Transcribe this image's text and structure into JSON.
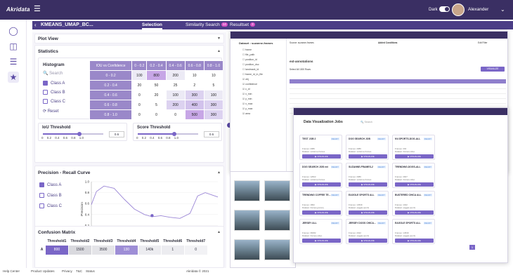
{
  "app": {
    "logo": "Akridata",
    "theme_label": "Dark",
    "user_name": "Alexander"
  },
  "subheader": {
    "title": "KMEANS_UMAP_BC...",
    "tabs": [
      {
        "label": "Selection"
      },
      {
        "label": "Similarity Search",
        "badge": "14"
      },
      {
        "label": "Resultset",
        "badge": "3"
      }
    ]
  },
  "plot_view": {
    "title": "Plot View"
  },
  "statistics": {
    "title": "Statistics",
    "histogram": {
      "title": "Histogram",
      "search_placeholder": "Search",
      "classes": [
        {
          "label": "Class A",
          "checked": true
        },
        {
          "label": "Class B",
          "checked": false
        },
        {
          "label": "Class C",
          "checked": false
        }
      ],
      "reset": "Reset"
    },
    "heatmap": {
      "corner": "IOU vs Confidence",
      "cols": [
        "0 - 0.2",
        "0.2 - 0.4",
        "0.4 - 0.6",
        "0.6 - 0.8",
        "0.8 - 1.0"
      ],
      "rows": [
        {
          "label": "0 - 0.2",
          "vals": [
            "100",
            "800",
            "200",
            "10",
            "10"
          ]
        },
        {
          "label": "0.2 - 0.4",
          "vals": [
            "20",
            "50",
            "25",
            "2",
            "5"
          ]
        },
        {
          "label": "0.4 - 0.6",
          "vals": [
            "0",
            "20",
            "100",
            "300",
            "100"
          ]
        },
        {
          "label": "0.6 - 0.8",
          "vals": [
            "0",
            "5",
            "200",
            "400",
            "300"
          ]
        },
        {
          "label": "0.8 - 1.0",
          "vals": [
            "0",
            "0",
            "0",
            "500",
            "300"
          ]
        }
      ]
    },
    "iou_threshold": {
      "title": "IoU Threshold",
      "ticks": "0 0.2 0.4 0.6 0.8 1.0",
      "value": "0.6",
      "level": 0.6
    },
    "score_threshold": {
      "title": "Score Threshold",
      "ticks": "0 0.2 0.4 0.6 0.8 1.0",
      "value": "0.6",
      "level": 0.6
    }
  },
  "pr_curve": {
    "title": "Precision - Recall Curve",
    "classes": [
      {
        "label": "Class A",
        "checked": true
      },
      {
        "label": "Class B",
        "checked": false
      },
      {
        "label": "Class C",
        "checked": false
      }
    ]
  },
  "chart_data": {
    "type": "line",
    "xlabel": "Recall",
    "ylabel": "Precision",
    "xlim": [
      0,
      1
    ],
    "ylim": [
      0,
      1
    ],
    "x_ticks": [
      "0.0",
      "0.2",
      "0.4",
      "0.6",
      "0.8",
      "1.0"
    ],
    "y_ticks": [
      "0.0",
      "0.2",
      "0.4",
      "0.6",
      "0.8",
      "1.0"
    ],
    "series": [
      {
        "x": [
          0,
          0.04,
          0.1,
          0.18,
          0.26,
          0.34,
          0.42,
          0.48,
          0.55,
          0.62,
          0.7,
          0.78,
          0.84,
          0.9,
          0.95,
          1.0
        ],
        "y": [
          0.58,
          0.82,
          0.92,
          0.88,
          0.68,
          0.5,
          0.4,
          0.36,
          0.38,
          0.35,
          0.33,
          0.42,
          0.74,
          0.8,
          0.76,
          0.72
        ]
      }
    ],
    "marker": {
      "x": 0.48,
      "y": 0.38
    }
  },
  "confusion": {
    "title": "Confusion Matrix",
    "headers": [
      "Threshold1",
      "Threshold2",
      "Threshold3",
      "Threshold4",
      "Threshold5",
      "Threshold6",
      "Threshold7"
    ],
    "row": {
      "label": "A",
      "vals": [
        "800",
        "1500",
        "3500",
        "130",
        "140k",
        "1",
        "0"
      ]
    }
  },
  "footer": {
    "help": "Help Center",
    "updates": "Product Updates",
    "privacy": "Privacy",
    "tc": "T&C",
    "status": "Status",
    "copy": "Akridata © 2021"
  },
  "overlay1": {
    "dataset_label": "Dataset : suzanne-frames",
    "fields": [
      "frame",
      "file_path",
      "position_id",
      "position_dsc",
      "landmark_id",
      "frame_id_in_file",
      "obj",
      "confidence",
      "c_id",
      "x_min",
      "y_min",
      "x_max",
      "y_max",
      "area"
    ],
    "source_label": "Source: suzanne-frames",
    "added_conditions": "Added Conditions",
    "edit_filter": "Edit Filter",
    "results_title": "ext-annotations",
    "select_all": "Select All 1000 Rows",
    "visualize": "VISUALIZE"
  },
  "overlay2": {
    "title": "Data Visualization Jobs",
    "search": "Search",
    "page": "1",
    "cards": [
      {
        "t": "TEST JOB 2",
        "s": "READY",
        "f": "2986",
        "d": "suzanne-frames"
      },
      {
        "t": "DOG SEARCH JOB",
        "s": "READY",
        "f": "2986",
        "d": "suzanne-frames"
      },
      {
        "t": "NV-SPORTS-DOG-ALL",
        "s": "READY",
        "f": "402",
        "d": "frames-video"
      },
      {
        "t": "DOG SEARCH JOB ext",
        "s": "READY",
        "f": "12822",
        "d": "suzanne-frames"
      },
      {
        "t": "SUZANNE-FRAMES-2",
        "s": "READY",
        "f": "2986",
        "d": "suzanne-frames"
      },
      {
        "t": "TRENDING-DOGS-ALL",
        "s": "READY",
        "f": "4907",
        "d": "frames-video"
      },
      {
        "t": "TRENDING COFFEE TE...",
        "s": "READY",
        "f": "1862",
        "d": "frames-grocery"
      },
      {
        "t": "EAGGLE SPORTS ALL",
        "s": "READY",
        "f": "14539",
        "d": "eaggle-sports"
      },
      {
        "t": "BUSTERED CHICA ALL",
        "s": "READY",
        "f": "1022",
        "d": "eaggle-sports"
      },
      {
        "t": "JERSEY ALL",
        "s": "READY",
        "f": "36082",
        "d": "frames-video"
      },
      {
        "t": "JERSEY DOGS CHICA...",
        "s": "READY",
        "f": "2022",
        "d": "eaggle-sports"
      },
      {
        "t": "EAGGLE SPORTS ALL",
        "s": "READY",
        "f": "14539",
        "d": "eaggle-sports"
      }
    ],
    "visualize": "VISUALIZE"
  }
}
